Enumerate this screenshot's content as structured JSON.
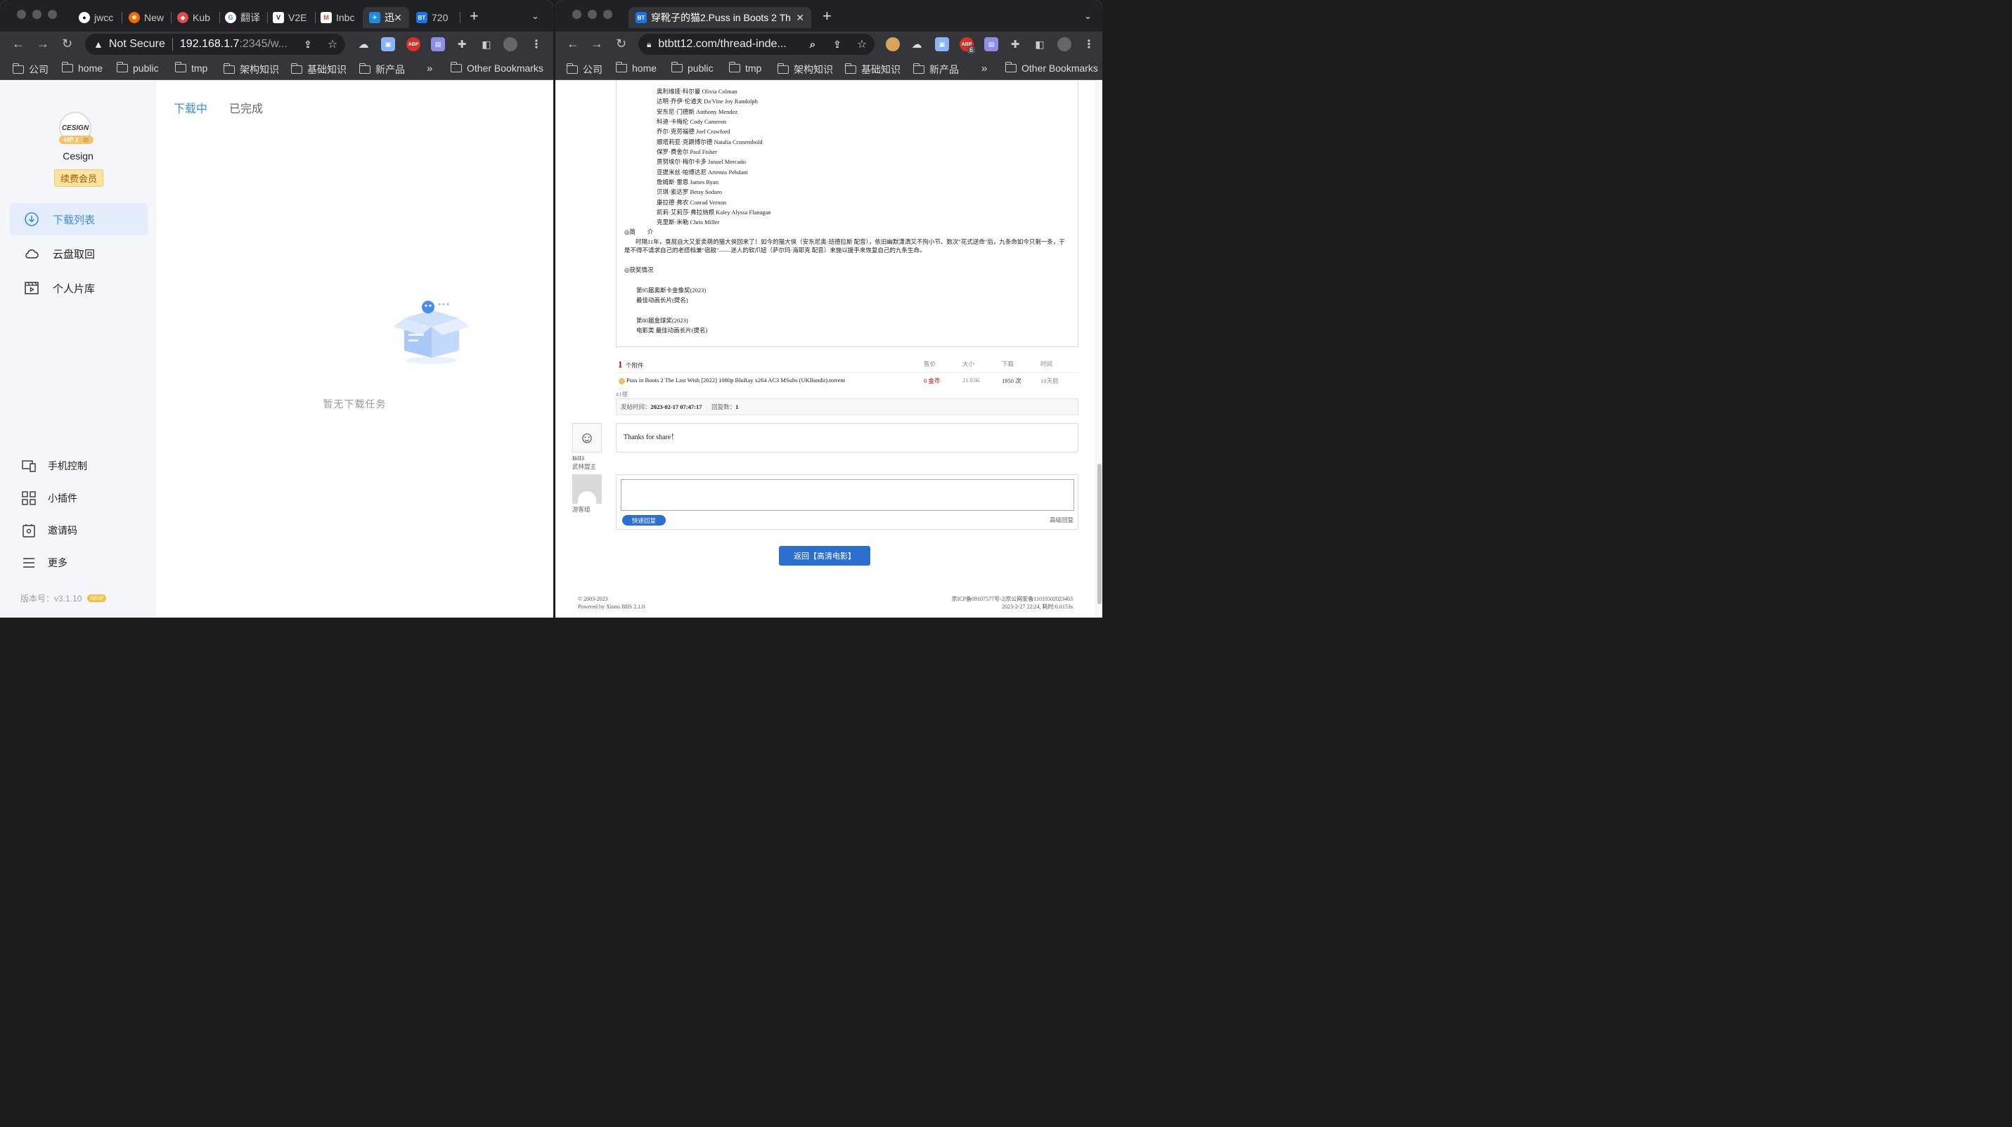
{
  "left_browser": {
    "tabs": [
      {
        "label": "jwcc",
        "icon": "github-icon",
        "color": "#ffffff"
      },
      {
        "label": "New",
        "icon": "grafana-icon",
        "color": "#f46800"
      },
      {
        "label": "Kub",
        "icon": "kuboard-icon",
        "color": "#e5484d"
      },
      {
        "label": "翻译",
        "icon": "google-icon",
        "color": "#4285f4"
      },
      {
        "label": "V2E",
        "icon": "v2ex-icon",
        "color": "#ffffff"
      },
      {
        "label": "Inbc",
        "icon": "gmail-icon",
        "color": "#ea4335"
      },
      {
        "label": "迅",
        "icon": "xunlei-icon",
        "color": "#1e88e5"
      },
      {
        "label": "720",
        "icon": "bt-icon",
        "color": "#1a73e8"
      }
    ],
    "security": "Not Secure",
    "url_host": "192.168.1.7",
    "url_rest": ":2345/w...",
    "bookmarks": [
      "公司",
      "home",
      "public",
      "tmp",
      "架构知识",
      "基础知识",
      "新产品"
    ],
    "other_bookmarks": "Other Bookmarks",
    "app": {
      "username": "Cesign",
      "vip_label": "VIP 1",
      "vip_unit": "年",
      "renew_label": "续费会员",
      "menu": [
        "下载列表",
        "云盘取回",
        "个人片库"
      ],
      "bottom_menu": [
        "手机控制",
        "小插件",
        "邀请码",
        "更多"
      ],
      "version_label": "版本号：v3.1.10",
      "new_badge": "NEW",
      "tabs": [
        "下载中",
        "已完成"
      ],
      "empty_text": "暂无下载任务",
      "accent": "#3d8bef"
    }
  },
  "right_browser": {
    "tab_title": "穿靴子的猫2.Puss in Boots 2 Th",
    "url": "btbtt12.com/thread-inde...",
    "bookmarks": [
      "公司",
      "home",
      "public",
      "tmp",
      "架构知识",
      "基础知识",
      "新产品"
    ],
    "other_bookmarks": "Other Bookmarks",
    "ext_badge": "6",
    "cast": [
      "奥利维娅·科尔曼 Olivia Colman",
      "达明·乔伊·伦道夫 Da'Vine Joy Randolph",
      "安东尼·门德斯 Anthony Mendez",
      "科迪·卡梅伦 Cody Cameron",
      "乔尔·克劳福德 Joel Crawford",
      "娜塔莉亚·克朗博尔德 Natalia Cronembold",
      "保罗·费舍尔 Paul Fisher",
      "贾努埃尔·梅尔卡多 Januel Mercado",
      "亚提米丝·帕博达尼 Artemis Pebdani",
      "詹姆斯·雷恩 James Ryan",
      "贝琪·索达罗 Betsy Sodaro",
      "康拉德·弗农 Conrad Vernon",
      "凯莉·艾莉莎·弗拉纳根 Kaley Alyssa Flanagan",
      "克里斯·米勒 Chris Miller"
    ],
    "intro_heading": "◎简　　介",
    "intro_text": "时隔11年，臭屁自大又爱卖萌的猫大侠回来了！如今的猫大侠（安东尼奥·班德拉斯 配音），依旧幽默潇洒又不拘小节、数次\"花式送命\"后，九条命如今只剩一条，于是不得不请求自己的老搭档兼\"宿敌\"——迷人的软爪妞（萨尔玛·海耶克 配音）来施以援手来恢复自己的九条生命。",
    "awards_heading": "◎获奖情况",
    "awards": [
      "第95届奥斯卡金像奖(2023)",
      "最佳动画长片(提名)",
      "第80届金球奖(2023)",
      "电影类 最佳动画长片(提名)"
    ],
    "attach_count": "1",
    "attach_label": "个附件",
    "attach_headers": [
      "售价",
      "大小",
      "下载",
      "时间"
    ],
    "attachment": {
      "name": "Puss in Boots 2 The Last Wish [2022] 1080p BluRay x264 AC3 MSubs (UKBandit).torrent",
      "price": "0 金币",
      "size": "21.83K",
      "downloads": "1950 次",
      "time": "10天前"
    },
    "floor": "#1楼",
    "post_time_label": "发帖时间：",
    "post_time": "2023-02-17 07:47:17",
    "reply_count_label": "回复数：",
    "reply_count": "1",
    "reply_user": "Bill3",
    "reply_role": "武林盟主",
    "reply_text": "Thanks for share！",
    "guest_label": "游客组",
    "quick_reply": "快速回复",
    "advanced_reply": "高级回复",
    "back_button": "返回【高清电影】",
    "footer_left": [
      "© 2003-2023",
      "Powered by Xiuno BBS 2.1.0"
    ],
    "footer_right": [
      "京ICP备09107577号-2|京公网安备11010502023463",
      "2023-2-27 22:24, 耗时:0.0153s"
    ]
  }
}
